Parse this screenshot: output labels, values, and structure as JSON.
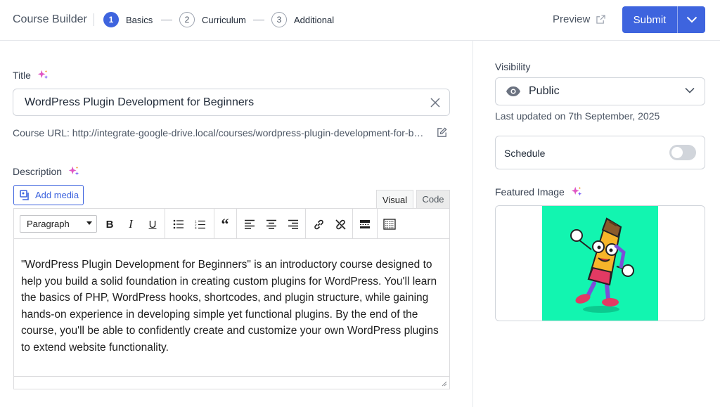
{
  "header": {
    "app_title": "Course Builder",
    "steps": [
      {
        "num": "1",
        "label": "Basics",
        "active": true
      },
      {
        "num": "2",
        "label": "Curriculum",
        "active": false
      },
      {
        "num": "3",
        "label": "Additional",
        "active": false
      }
    ],
    "preview_label": "Preview",
    "submit_label": "Submit"
  },
  "main": {
    "title_label": "Title",
    "title_value": "WordPress Plugin Development for Beginners",
    "course_url": "Course URL: http://integrate-google-drive.local/courses/wordpress-plugin-development-for-beginners/",
    "description_label": "Description",
    "add_media_label": "Add media",
    "tabs": {
      "visual": "Visual",
      "code": "Code"
    },
    "format_select": "Paragraph",
    "description_text": "\"WordPress Plugin Development for Beginners\" is an introductory course designed to help you build a solid foundation in creating custom plugins for WordPress. You'll learn the basics of PHP, WordPress hooks, shortcodes, and plugin structure, while gaining hands-on experience in developing simple yet functional plugins. By the end of the course, you'll be able to confidently create and customize your own WordPress plugins to extend website functionality."
  },
  "sidebar": {
    "visibility_label": "Visibility",
    "visibility_value": "Public",
    "last_updated": "Last updated on 7th September, 2025",
    "schedule_label": "Schedule",
    "schedule_enabled": false,
    "featured_image_label": "Featured Image"
  },
  "colors": {
    "accent": "#3e64de",
    "featured_bg": "#12f5b0"
  }
}
